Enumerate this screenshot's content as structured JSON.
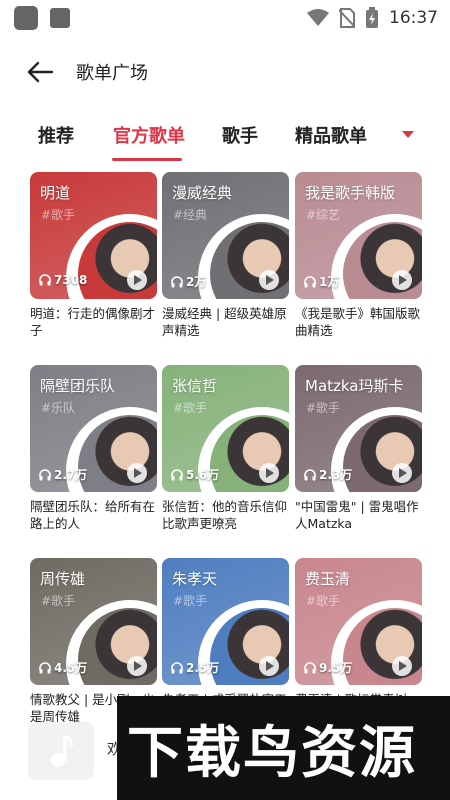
{
  "status_bar": {
    "time": "16:37"
  },
  "header": {
    "title": "歌单广场"
  },
  "tabs": [
    {
      "label": "推荐",
      "active": false
    },
    {
      "label": "官方歌单",
      "active": true
    },
    {
      "label": "歌手",
      "active": false
    },
    {
      "label": "精品歌单",
      "active": false
    }
  ],
  "accent_color": "#e03546",
  "cards": [
    {
      "name": "明道",
      "tag": "#歌手",
      "plays": "7308",
      "caption": "明道：行走的偶像剧才子",
      "bg": "#c83a3a"
    },
    {
      "name": "漫威经典",
      "tag": "#经典",
      "plays": "2万",
      "caption": "漫威经典 | 超级英雄原声精选",
      "bg": "#6f6f74"
    },
    {
      "name": "我是歌手韩版",
      "tag": "#综艺",
      "plays": "1万",
      "caption": "《我是歌手》韩国版歌曲精选",
      "bg": "#b98b93"
    },
    {
      "name": "隔壁团乐队",
      "tag": "#乐队",
      "plays": "2.7万",
      "caption": "隔壁团乐队：给所有在路上的人",
      "bg": "#7e7f86"
    },
    {
      "name": "张信哲",
      "tag": "#歌手",
      "plays": "5.6万",
      "caption": "张信哲：他的音乐信仰比歌声更嘹亮",
      "bg": "#86b27a"
    },
    {
      "name": "Matzka玛斯卡",
      "tag": "#歌手",
      "plays": "2.3万",
      "caption": "\"中国雷鬼\" | 雷鬼唱作人Matzka",
      "bg": "#7c6a70"
    },
    {
      "name": "周传雄",
      "tag": "#歌手",
      "plays": "4.5万",
      "caption": "情歌教父 | 是小刚，也是周传雄",
      "bg": "#6f6b63"
    },
    {
      "name": "朱孝天",
      "tag": "#歌手",
      "plays": "2.5万",
      "caption": "朱孝天 | 成采翠朴容天",
      "bg": "#4f7ec0"
    },
    {
      "name": "费玉清",
      "tag": "#歌手",
      "plays": "9.5万",
      "caption": "费玉清 | 歌坛常青树",
      "bg": "#c8868d"
    }
  ],
  "watermark": {
    "text": "下载鸟资源"
  },
  "mini_player": {
    "text": "欢"
  }
}
